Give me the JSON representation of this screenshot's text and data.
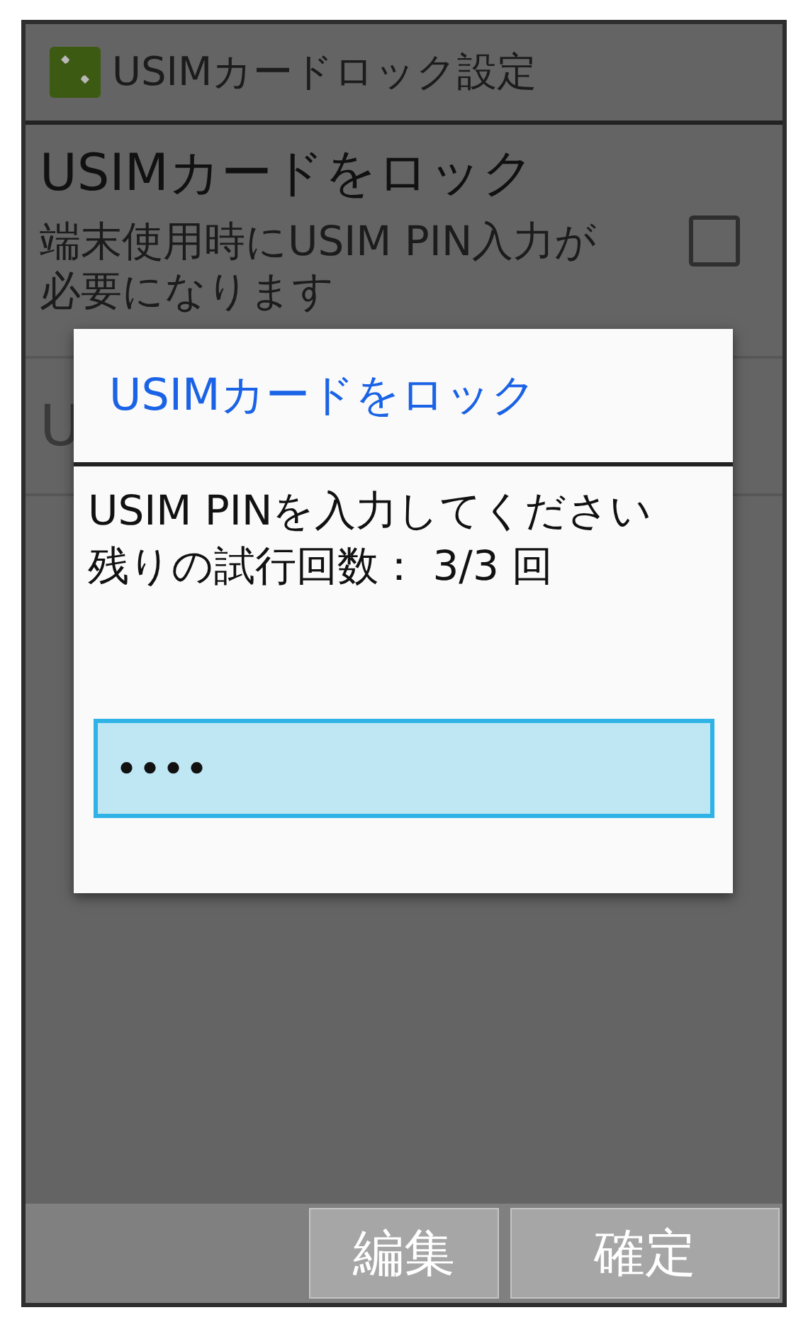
{
  "header": {
    "title": "USIMカードロック設定"
  },
  "settings": [
    {
      "kind": "checkbox",
      "title": "USIMカードをロック",
      "summary": "端末使用時にUSIM PIN入力が必要になります",
      "checked": false
    },
    {
      "kind": "plain",
      "title": "U"
    }
  ],
  "dialog": {
    "title": "USIMカードをロック",
    "message": "USIM PINを入力してください",
    "attempts": "残りの試行回数： 3/3 回",
    "pin": {
      "value": "••••"
    }
  },
  "buttons": [
    "編集",
    "確定"
  ]
}
